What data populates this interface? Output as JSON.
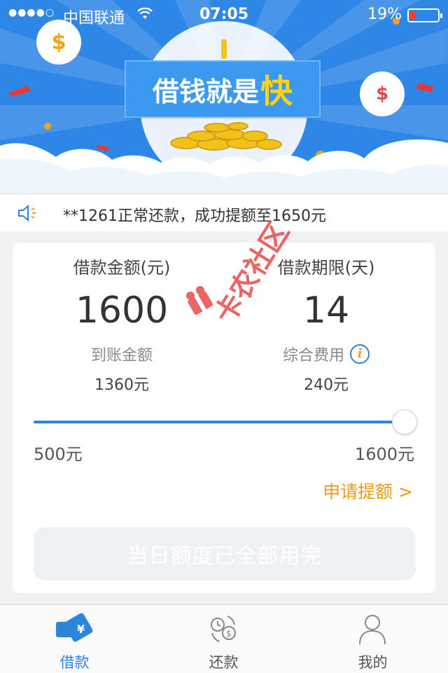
{
  "status_bar": {
    "signal": "●●●●○",
    "carrier": "中国联通",
    "time": "07:05",
    "battery": "19%"
  },
  "hero": {
    "title_main": "借钱就是",
    "title_accent": "快",
    "bubble_left_symbol": "$",
    "bubble_right_symbol": "$"
  },
  "notice": {
    "text": "**1261正常还款，成功提额至1650元"
  },
  "loan": {
    "amount_label": "借款金额(元)",
    "amount_value": "1600",
    "term_label": "借款期限(天)",
    "term_value": "14",
    "received_label": "到账金额",
    "received_value": "1360元",
    "fee_label": "综合费用",
    "fee_value": "240元",
    "info_symbol": "i",
    "slider": {
      "min_label": "500元",
      "max_label": "1600元",
      "min": 500,
      "max": 1600,
      "value": 1600
    },
    "apply_link": "申请提额 >",
    "button_label": "当日额度已全部用完"
  },
  "watermark": {
    "text": "卡农社区"
  },
  "tabbar": {
    "tabs": [
      {
        "label": "借款",
        "icon": "wallet-card-icon",
        "active": true
      },
      {
        "label": "还款",
        "icon": "repay-cycle-icon",
        "active": false
      },
      {
        "label": "我的",
        "icon": "person-icon",
        "active": false
      }
    ]
  },
  "colors": {
    "primary_blue": "#2b86d9",
    "hero_blue": "#2e86e6",
    "accent_orange": "#ee9a10",
    "accent_yellow": "#ffd21f"
  }
}
